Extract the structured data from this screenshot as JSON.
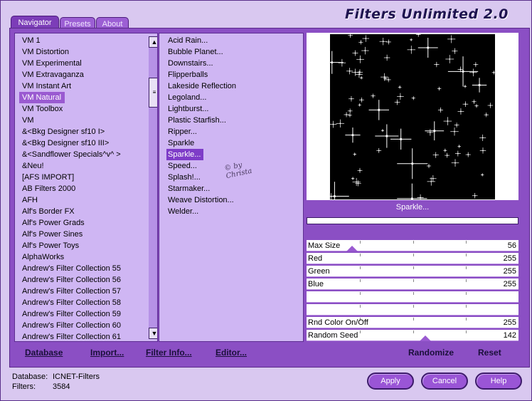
{
  "title": "Filters Unlimited 2.0",
  "tabs": [
    {
      "label": "Navigator",
      "active": true
    },
    {
      "label": "Presets",
      "active": false
    },
    {
      "label": "About",
      "active": false
    }
  ],
  "categories": [
    "VM 1",
    "VM Distortion",
    "VM Experimental",
    "VM Extravaganza",
    "VM Instant Art",
    "VM Natural",
    "VM Toolbox",
    "VM",
    "&<Bkg Designer sf10 I>",
    "&<Bkg Designer sf10 III>",
    "&<Sandflower Specials^v^ >",
    "&Neu!",
    "[AFS IMPORT]",
    "AB Filters 2000",
    "AFH",
    "Alf's Border FX",
    "Alf's Power Grads",
    "Alf's Power Sines",
    "Alf's Power Toys",
    "AlphaWorks",
    "Andrew's Filter Collection 55",
    "Andrew's Filter Collection 56",
    "Andrew's Filter Collection 57",
    "Andrew's Filter Collection 58",
    "Andrew's Filter Collection 59",
    "Andrew's Filter Collection 60",
    "Andrew's Filter Collection 61"
  ],
  "selected_category": "VM Natural",
  "filters": [
    "Acid Rain...",
    "Bubble Planet...",
    "Downstairs...",
    "Flipperballs",
    "Lakeside Reflection",
    "Legoland...",
    "Lightburst...",
    "Plastic Starfish...",
    "Ripper...",
    "Sparkle",
    "Sparkle...",
    "Speed...",
    "Splash!...",
    "Starmaker...",
    "Weave Distortion...",
    "Welder..."
  ],
  "selected_filter": "Sparkle...",
  "watermark": "© by Christa",
  "preview": {
    "label": "Sparkle...",
    "progress": 0
  },
  "sliders": [
    {
      "name": "Max Size",
      "value": "56"
    },
    {
      "name": "Red",
      "value": "255"
    },
    {
      "name": "Green",
      "value": "255"
    },
    {
      "name": "Blue",
      "value": "255"
    },
    {
      "name": "",
      "value": ""
    },
    {
      "name": "",
      "value": ""
    },
    {
      "name": "Rnd Color On/Off",
      "value": "255"
    },
    {
      "name": "Random Seed",
      "value": "142"
    }
  ],
  "bottom_links": [
    "Database",
    "Import...",
    "Filter Info...",
    "Editor..."
  ],
  "right_links": [
    "Randomize",
    "Reset"
  ],
  "status": {
    "database_label": "Database:",
    "database_value": "ICNET-Filters",
    "filters_label": "Filters:",
    "filters_value": "3584"
  },
  "buttons": {
    "apply": "Apply",
    "cancel": "Cancel",
    "help": "Help"
  },
  "colors": {
    "panel": "#8b4fc4",
    "list": "#cfb6f3",
    "selection": "#9a5ad1",
    "window": "#d9c8f0"
  }
}
